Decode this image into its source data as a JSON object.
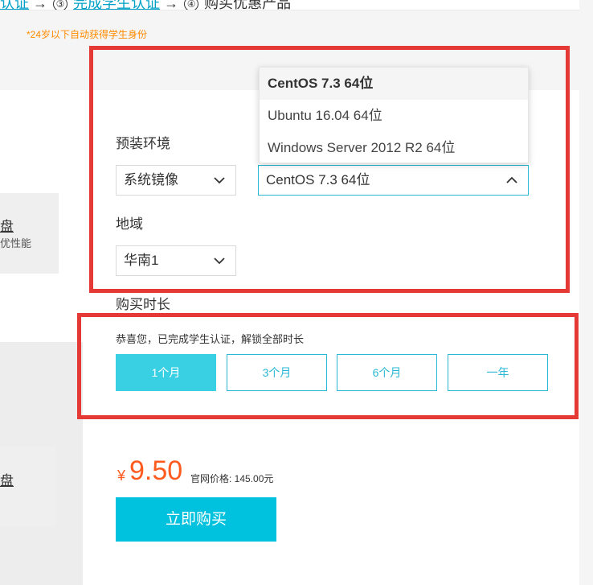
{
  "steps": {
    "prev_link": "认证",
    "arrow": "→",
    "step3_num": "③",
    "step3_label": "完成学生认证",
    "step4_num": "④",
    "step4_label": "购买优惠产品"
  },
  "notice": "*24岁以下自动获得学生身份",
  "left_cards": [
    {
      "title": "盘",
      "subtitle": "优性能"
    },
    {
      "title": "盘"
    }
  ],
  "env": {
    "label": "预装环境",
    "image_select": "系统镜像",
    "os_select": "CentOS 7.3 64位",
    "os_options": [
      "CentOS 7.3 64位",
      "Ubuntu 16.04 64位",
      "Windows Server 2012 R2 64位"
    ],
    "selected_option_index": 0
  },
  "region": {
    "label": "地域",
    "select": "华南1"
  },
  "duration": {
    "label": "购买时长",
    "congrats": "恭喜您，已完成学生认证，解锁全部时长",
    "options": [
      "1个月",
      "3个月",
      "6个月",
      "一年"
    ],
    "selected_index": 0
  },
  "price": {
    "symbol": "¥",
    "value": "9.50",
    "official": "官网价格: 145.00元"
  },
  "buy_button": "立即购买",
  "colors": {
    "accent": "#00c1de",
    "price": "#ff5a1f",
    "highlight_red": "#e53935",
    "notice_orange": "#ff8a00"
  }
}
